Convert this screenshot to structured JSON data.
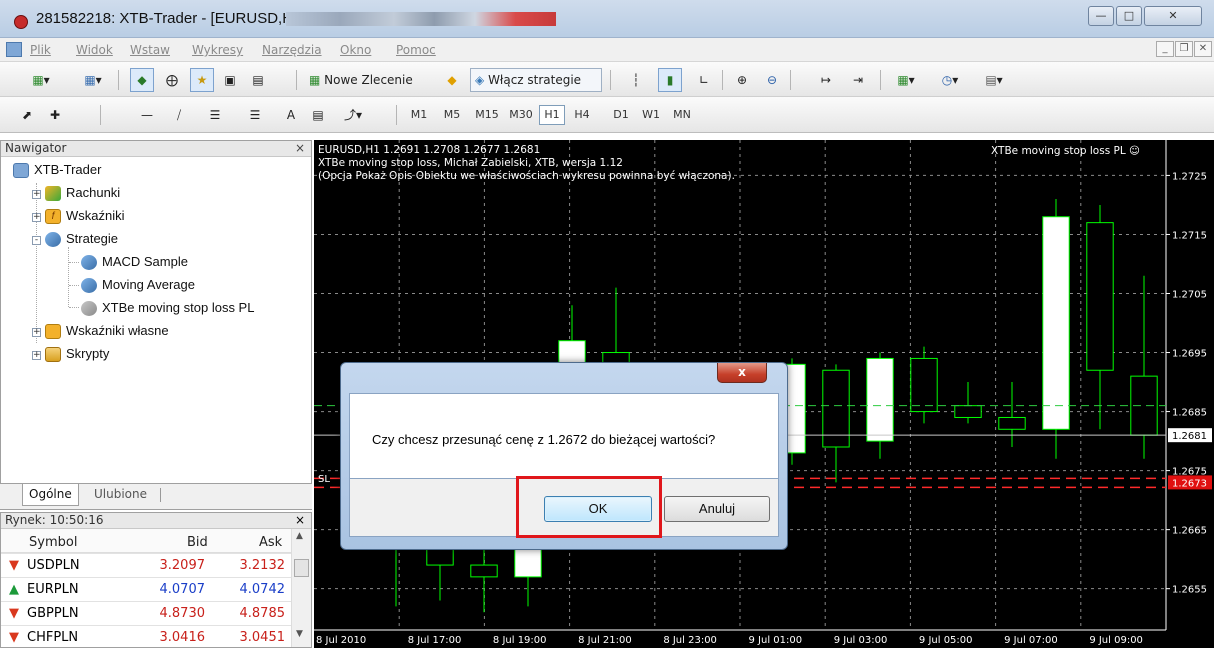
{
  "window": {
    "title": "281582218: XTB-Trader - [EURUSD,H1]"
  },
  "menu": {
    "items": [
      "Plik",
      "Widok",
      "Wstaw",
      "Wykresy",
      "Narzędzia",
      "Okno",
      "Pomoc"
    ]
  },
  "toolbar": {
    "new_order": "Nowe Zlecenie",
    "enable_strategies": "Włącz strategie"
  },
  "timeframes": {
    "items": [
      "M1",
      "M5",
      "M15",
      "M30",
      "H1",
      "H4",
      "D1",
      "W1",
      "MN"
    ],
    "selected": "H1"
  },
  "navigator": {
    "title": "Nawigator",
    "close": "×",
    "root": "XTB-Trader",
    "items": {
      "accounts": "Rachunki",
      "indicators": "Wskaźniki",
      "strategies": "Strategie",
      "macd": "MACD Sample",
      "ma": "Moving Average",
      "xtbe": "XTBe moving stop loss PL",
      "custom_indicators": "Wskaźniki własne",
      "scripts": "Skrypty"
    },
    "tabs": {
      "general": "Ogólne",
      "favorites": "Ulubione"
    }
  },
  "market": {
    "title": "Rynek: 10:50:16",
    "close": "×",
    "headers": {
      "symbol": "Symbol",
      "bid": "Bid",
      "ask": "Ask"
    },
    "rows": [
      {
        "symbol": "USDPLN",
        "bid": "3.2097",
        "ask": "3.2132",
        "dir": "down"
      },
      {
        "symbol": "EURPLN",
        "bid": "4.0707",
        "ask": "4.0742",
        "dir": "up"
      },
      {
        "symbol": "GBPPLN",
        "bid": "4.8730",
        "ask": "4.8785",
        "dir": "down"
      },
      {
        "symbol": "CHFPLN",
        "bid": "3.0416",
        "ask": "3.0451",
        "dir": "down"
      }
    ]
  },
  "chart": {
    "info_line1": "EURUSD,H1  1.2691 1.2708 1.2677 1.2681",
    "info_line2": "XTBe moving stop loss, Michał Zabielski, XTB, wersja 1.12",
    "info_line3": "(Opcja Pokaż Opis Obiektu we właściwościach wykresu powinna być włączona).",
    "ea_label": "XTBe moving stop loss PL",
    "sl_label": "SL",
    "colors": {
      "bg": "#000000",
      "up": "#ffffff",
      "down": "#000000",
      "wick": "#00ff00",
      "grid": "#8a8a8a",
      "bid": "#ffffff",
      "stop": "#ff2a2a",
      "target": "#2ecc40"
    }
  },
  "chart_data": {
    "type": "candlestick",
    "y_ticks": [
      "1.2725",
      "1.2715",
      "1.2705",
      "1.2695",
      "1.2685",
      "1.2675",
      "1.2665",
      "1.2655"
    ],
    "y_range": [
      1.2648,
      1.2731
    ],
    "bid_label": "1.2681",
    "stop_label": "1.2673",
    "bid": 1.2681,
    "stop": 1.2673,
    "target": 1.2686,
    "x_labels": [
      "8 Jul 2010",
      "8 Jul 17:00",
      "8 Jul 19:00",
      "8 Jul 21:00",
      "8 Jul 23:00",
      "9 Jul 01:00",
      "9 Jul 03:00",
      "9 Jul 05:00",
      "9 Jul 07:00",
      "9 Jul 09:00"
    ],
    "candles": [
      {
        "o": 1.2687,
        "h": 1.2689,
        "l": 1.2652,
        "c": 1.2662
      },
      {
        "o": 1.267,
        "h": 1.2674,
        "l": 1.2653,
        "c": 1.2659
      },
      {
        "o": 1.2659,
        "h": 1.2668,
        "l": 1.2651,
        "c": 1.2657
      },
      {
        "o": 1.2657,
        "h": 1.2678,
        "l": 1.2652,
        "c": 1.2673
      },
      {
        "o": 1.2673,
        "h": 1.2703,
        "l": 1.2668,
        "c": 1.2697
      },
      {
        "o": 1.2695,
        "h": 1.2706,
        "l": 1.2676,
        "c": 1.2681
      },
      {
        "o": 1.2681,
        "h": 1.269,
        "l": 1.2675,
        "c": 1.268
      },
      {
        "o": 1.268,
        "h": 1.2693,
        "l": 1.2676,
        "c": 1.2679
      },
      {
        "o": 1.2679,
        "h": 1.2681,
        "l": 1.2676,
        "c": 1.2678
      },
      {
        "o": 1.2678,
        "h": 1.2694,
        "l": 1.2676,
        "c": 1.2693
      },
      {
        "o": 1.2692,
        "h": 1.2693,
        "l": 1.2673,
        "c": 1.2679
      },
      {
        "o": 1.268,
        "h": 1.2695,
        "l": 1.2677,
        "c": 1.2694
      },
      {
        "o": 1.2694,
        "h": 1.2696,
        "l": 1.2683,
        "c": 1.2685
      },
      {
        "o": 1.2686,
        "h": 1.269,
        "l": 1.2683,
        "c": 1.2684
      },
      {
        "o": 1.2684,
        "h": 1.269,
        "l": 1.2679,
        "c": 1.2682
      },
      {
        "o": 1.2682,
        "h": 1.2721,
        "l": 1.2677,
        "c": 1.2718
      },
      {
        "o": 1.2717,
        "h": 1.272,
        "l": 1.2682,
        "c": 1.2692
      },
      {
        "o": 1.2691,
        "h": 1.2708,
        "l": 1.2677,
        "c": 1.2681
      }
    ]
  },
  "dialog": {
    "message": "Czy chcesz przesunąć cenę z  1.2672 do bieżącej wartości?",
    "ok": "OK",
    "cancel": "Anuluj",
    "close": "x"
  }
}
